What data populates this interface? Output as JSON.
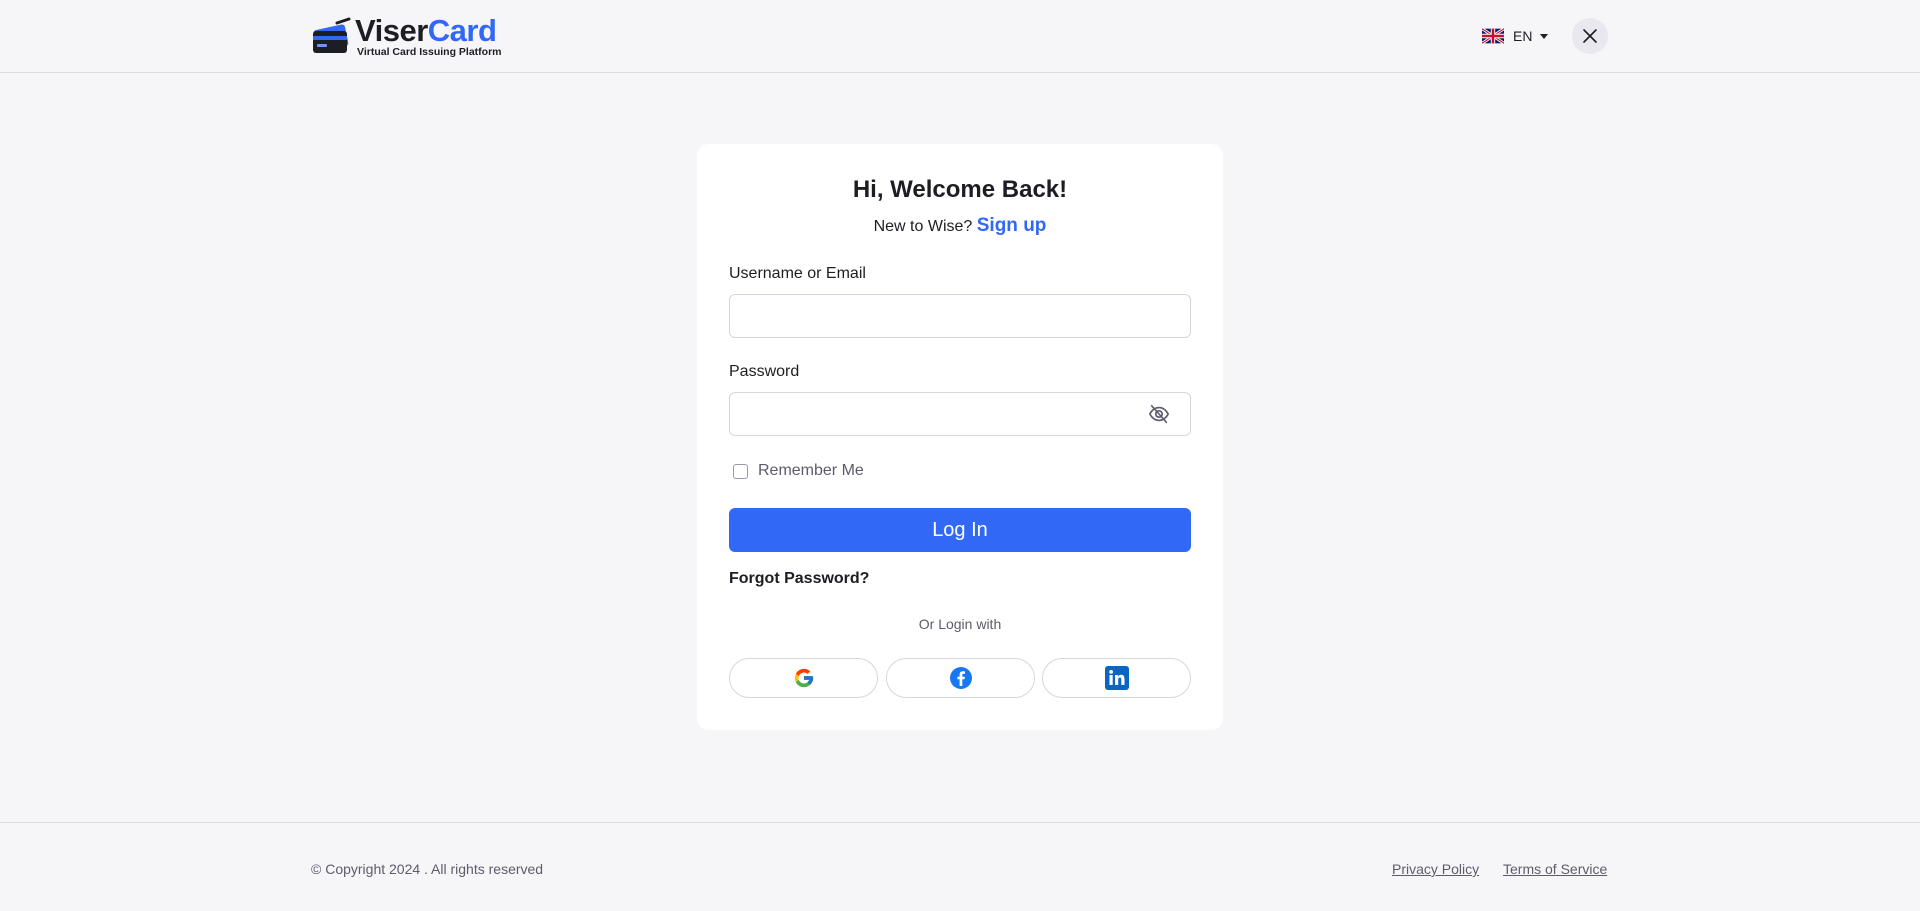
{
  "brand": {
    "name_part1": "Viser",
    "name_part2": "Card",
    "tagline": "Virtual Card Issuing Platform",
    "primary_color": "#3268f6"
  },
  "header": {
    "language": {
      "code": "EN",
      "flag_icon": "uk-flag-icon"
    },
    "close_icon": "close-icon"
  },
  "login": {
    "title": "Hi, Welcome Back!",
    "subtitle_prefix": "New to Wise?",
    "signup_link": "Sign up",
    "username_label": "Username or Email",
    "username_value": "",
    "password_label": "Password",
    "password_value": "",
    "remember_label": "Remember Me",
    "remember_checked": false,
    "submit_label": "Log In",
    "forgot_label": "Forgot Password?",
    "or_login_with": "Or Login with",
    "social": [
      {
        "icon": "google-icon"
      },
      {
        "icon": "facebook-icon"
      },
      {
        "icon": "linkedin-icon"
      }
    ]
  },
  "footer": {
    "copyright": "© Copyright 2024 . All rights reserved",
    "privacy": "Privacy Policy",
    "terms": "Terms of Service"
  }
}
